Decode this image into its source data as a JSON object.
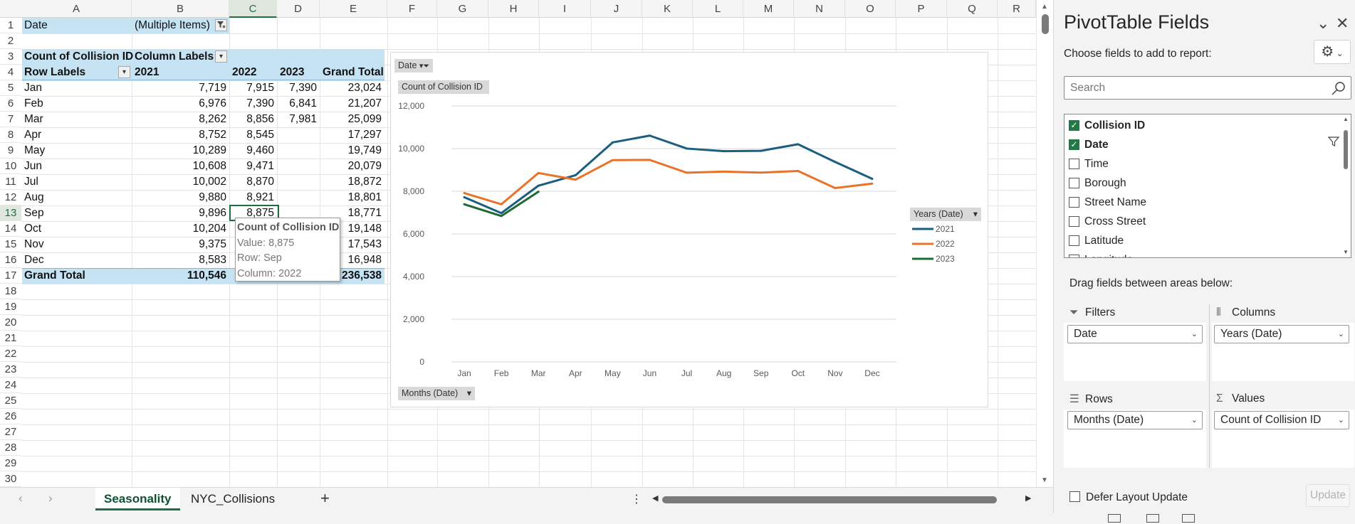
{
  "columns": [
    "A",
    "B",
    "C",
    "D",
    "E",
    "F",
    "G",
    "H",
    "I",
    "J",
    "K",
    "L",
    "M",
    "N",
    "O",
    "P",
    "Q",
    "R"
  ],
  "rows": [
    "1",
    "2",
    "3",
    "4",
    "5",
    "6",
    "7",
    "8",
    "9",
    "10",
    "11",
    "12",
    "13",
    "14",
    "15",
    "16",
    "17",
    "18",
    "19",
    "20",
    "21",
    "22",
    "23",
    "24",
    "25",
    "26",
    "27",
    "28",
    "29",
    "30"
  ],
  "pivot": {
    "filter_label": "Date",
    "filter_value": "(Multiple Items)",
    "values_header": "Count of Collision ID",
    "column_labels": "Column Labels",
    "row_labels": "Row Labels",
    "years": [
      "2021",
      "2022",
      "2023"
    ],
    "grand_total_label": "Grand Total",
    "data": [
      {
        "month": "Jan",
        "y2021": "7,719",
        "y2022": "7,915",
        "y2023": "7,390",
        "total": "23,024"
      },
      {
        "month": "Feb",
        "y2021": "6,976",
        "y2022": "7,390",
        "y2023": "6,841",
        "total": "21,207"
      },
      {
        "month": "Mar",
        "y2021": "8,262",
        "y2022": "8,856",
        "y2023": "7,981",
        "total": "25,099"
      },
      {
        "month": "Apr",
        "y2021": "8,752",
        "y2022": "8,545",
        "y2023": "",
        "total": "17,297"
      },
      {
        "month": "May",
        "y2021": "10,289",
        "y2022": "9,460",
        "y2023": "",
        "total": "19,749"
      },
      {
        "month": "Jun",
        "y2021": "10,608",
        "y2022": "9,471",
        "y2023": "",
        "total": "20,079"
      },
      {
        "month": "Jul",
        "y2021": "10,002",
        "y2022": "8,870",
        "y2023": "",
        "total": "18,872"
      },
      {
        "month": "Aug",
        "y2021": "9,880",
        "y2022": "8,921",
        "y2023": "",
        "total": "18,801"
      },
      {
        "month": "Sep",
        "y2021": "9,896",
        "y2022": "8,875",
        "y2023": "",
        "total": "18,771"
      },
      {
        "month": "Oct",
        "y2021": "10,204",
        "y2022": "",
        "y2023": "",
        "total": "19,148"
      },
      {
        "month": "Nov",
        "y2021": "9,375",
        "y2022": "",
        "y2023": "",
        "total": "17,543"
      },
      {
        "month": "Dec",
        "y2021": "8,583",
        "y2022": "",
        "y2023": "",
        "total": "16,948"
      }
    ],
    "grand_total": {
      "y2021": "110,546",
      "total": "236,538"
    }
  },
  "tooltip": {
    "title": "Count of Collision ID",
    "value": "Value: 8,875",
    "row": "Row: Sep",
    "column": "Column: 2022"
  },
  "chart_data": {
    "type": "line",
    "categories": [
      "Jan",
      "Feb",
      "Mar",
      "Apr",
      "May",
      "Jun",
      "Jul",
      "Aug",
      "Sep",
      "Oct",
      "Nov",
      "Dec"
    ],
    "series": [
      {
        "name": "2021",
        "color": "#1b5e7f",
        "values": [
          7719,
          6976,
          8262,
          8752,
          10289,
          10608,
          10002,
          9880,
          9896,
          10204,
          9375,
          8583
        ]
      },
      {
        "name": "2022",
        "color": "#e8732a",
        "values": [
          7915,
          7390,
          8856,
          8545,
          9460,
          9471,
          8870,
          8921,
          8875,
          8950,
          8150,
          8360
        ]
      },
      {
        "name": "2023",
        "color": "#1e6b32",
        "values": [
          7390,
          6841,
          7981
        ]
      }
    ],
    "y_ticks": [
      "0",
      "2,000",
      "4,000",
      "6,000",
      "8,000",
      "10,000",
      "12,000"
    ],
    "ylim": [
      0,
      12000
    ],
    "field_buttons": {
      "filter": "Date",
      "values": "Count of Collision ID",
      "axis": "Months (Date)",
      "legend": "Years (Date)"
    },
    "grid": true,
    "legend_position": "right"
  },
  "sheet_tabs": [
    "Seasonality",
    "NYC_Collisions"
  ],
  "pane": {
    "title": "PivotTable Fields",
    "subtitle": "Choose fields to add to report:",
    "search_placeholder": "Search",
    "fields": [
      {
        "name": "Collision ID",
        "checked": true
      },
      {
        "name": "Date",
        "checked": true
      },
      {
        "name": "Time",
        "checked": false
      },
      {
        "name": "Borough",
        "checked": false
      },
      {
        "name": "Street Name",
        "checked": false
      },
      {
        "name": "Cross Street",
        "checked": false
      },
      {
        "name": "Latitude",
        "checked": false
      },
      {
        "name": "Longitude",
        "checked": false
      }
    ],
    "drag_label": "Drag fields between areas below:",
    "areas": {
      "filters": {
        "label": "Filters",
        "value": "Date"
      },
      "columns": {
        "label": "Columns",
        "value": "Years (Date)"
      },
      "rows": {
        "label": "Rows",
        "value": "Months (Date)"
      },
      "values": {
        "label": "Values",
        "value": "Count of Collision ID"
      }
    },
    "defer_label": "Defer Layout Update",
    "update_label": "Update"
  },
  "colors": {
    "accent": "#1f6e43",
    "pivot_band": "#c6e3f3"
  }
}
